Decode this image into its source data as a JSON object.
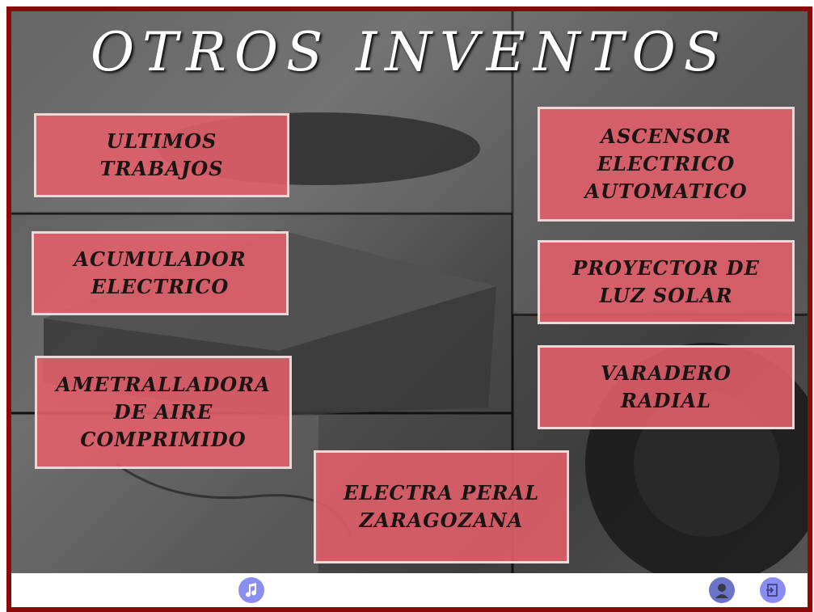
{
  "title": "OTROS INVENTOS",
  "buttons": {
    "ultimos": "ULTIMOS\nTRABAJOS",
    "acumulador": "ACUMULADOR\nELECTRICO",
    "ametralladora": "AMETRALLADORA\nDE AIRE\nCOMPRIMIDO",
    "electra": "ELECTRA PERAL\nZARAGOZANA",
    "ascensor": "ASCENSOR\nELECTRICO\nAUTOMATICO",
    "proyector": "PROYECTOR DE\nLUZ SOLAR",
    "varadero": "VARADERO\nRADIAL"
  },
  "toolbar": {
    "music_icon": "music-note-icon",
    "portrait_icon": "portrait-icon",
    "exit_icon": "exit-icon"
  },
  "colors": {
    "frame": "#8a0a0a",
    "button_fill": "#e5606b",
    "icon_blue": "#8a8ef0"
  }
}
